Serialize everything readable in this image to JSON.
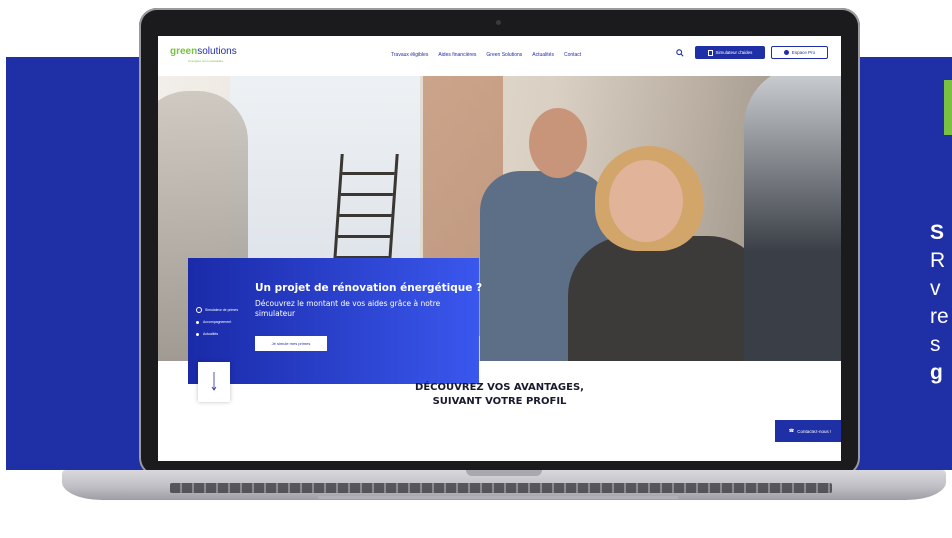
{
  "teaser": {
    "line1": "S",
    "line2": "R",
    "line3": "v",
    "line4": "re",
    "line5": "s",
    "line6": "g"
  },
  "site": {
    "logo_part1": "green",
    "logo_part2": "solutions",
    "logo_tagline": "énergies renouvelables",
    "nav": [
      "Travaux éligibles",
      "Aides financières",
      "Green Solutions",
      "Actualités",
      "Contact"
    ],
    "simulator_button": "Simulateur d'aides",
    "pro_button": "Espace Pro"
  },
  "hero": {
    "title": "Un projet de rénovation énergétique ?",
    "text": "Découvrez le montant de vos aides grâce à notre simulateur",
    "cta": "Je simule mes primes",
    "side_nav": [
      "Simulateur de primes",
      "Accompagnement",
      "Actualités"
    ]
  },
  "section": {
    "title_line1": "DÉCOUVREZ VOS AVANTAGES,",
    "title_line2": "SUIVANT VOTRE PROFIL"
  },
  "contact_button": "Contactez-nous !",
  "colors": {
    "brand_blue": "#1f2fa6",
    "brand_green": "#7ac143"
  }
}
